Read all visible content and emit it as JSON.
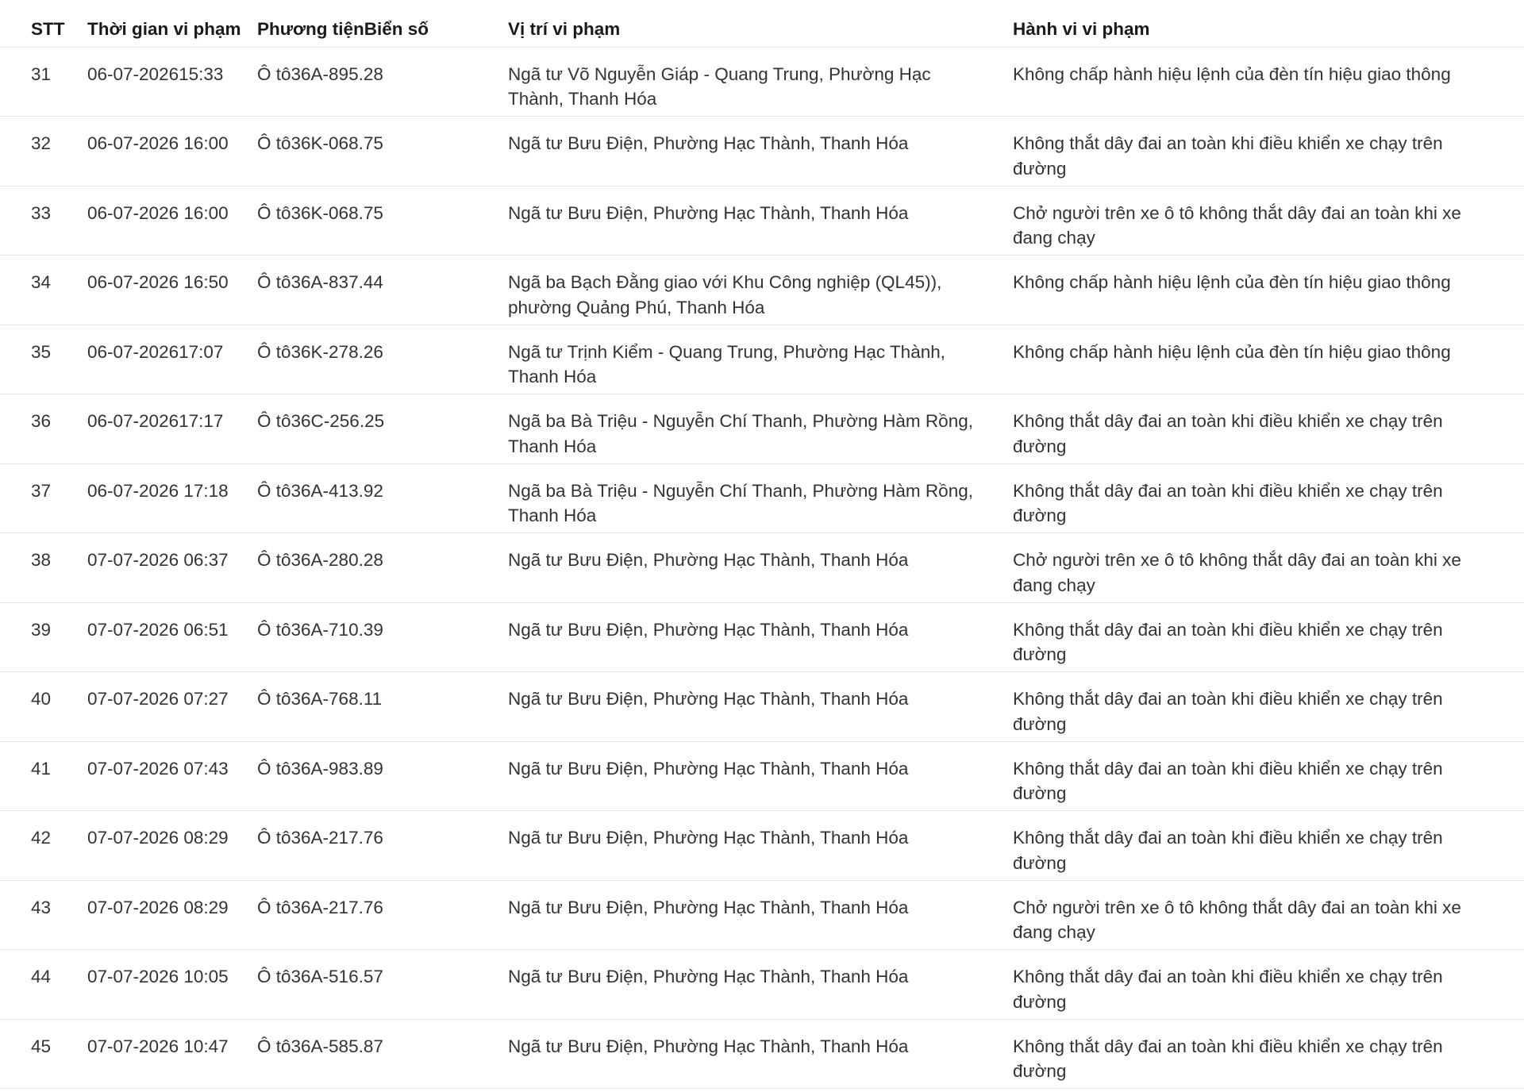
{
  "table": {
    "headers": {
      "stt": "STT",
      "time": "Thời gian vi phạm",
      "vehicle": "Phương tiệnBiển số",
      "location": "Vị trí vi phạm",
      "violation": "Hành vi vi phạm"
    },
    "rows": [
      {
        "stt": "31",
        "time": "06-07-202615:33",
        "vehicle": "Ô tô36A-895.28",
        "location": "Ngã tư Võ Nguyễn Giáp - Quang Trung, Phường Hạc Thành, Thanh Hóa",
        "violation": "Không chấp hành hiệu lệnh của đèn tín hiệu giao thông"
      },
      {
        "stt": "32",
        "time": "06-07-2026 16:00",
        "vehicle": "Ô tô36K-068.75",
        "location": "Ngã tư Bưu Điện, Phường Hạc Thành, Thanh Hóa",
        "violation": "Không thắt dây đai an toàn khi điều khiển xe chạy trên đường"
      },
      {
        "stt": "33",
        "time": "06-07-2026 16:00",
        "vehicle": "Ô tô36K-068.75",
        "location": "Ngã tư Bưu Điện, Phường Hạc Thành, Thanh Hóa",
        "violation": "Chở người trên xe ô tô không thắt dây đai an toàn khi xe đang chạy"
      },
      {
        "stt": "34",
        "time": "06-07-2026 16:50",
        "vehicle": "Ô tô36A-837.44",
        "location": "Ngã ba Bạch Đằng giao với Khu Công nghiệp (QL45)), phường Quảng Phú, Thanh Hóa",
        "violation": "Không chấp hành hiệu lệnh của đèn tín hiệu giao thông"
      },
      {
        "stt": "35",
        "time": "06-07-202617:07",
        "vehicle": "Ô tô36K-278.26",
        "location": "Ngã tư Trịnh Kiểm - Quang Trung, Phường Hạc Thành, Thanh Hóa",
        "violation": "Không chấp hành hiệu lệnh của đèn tín hiệu giao thông"
      },
      {
        "stt": "36",
        "time": "06-07-202617:17",
        "vehicle": "Ô tô36C-256.25",
        "location": "Ngã ba Bà Triệu - Nguyễn Chí Thanh, Phường Hàm Rồng, Thanh Hóa",
        "violation": "Không thắt dây đai an toàn khi điều khiển xe chạy trên đường"
      },
      {
        "stt": "37",
        "time": "06-07-2026 17:18",
        "vehicle": "Ô tô36A-413.92",
        "location": "Ngã ba Bà Triệu - Nguyễn Chí Thanh, Phường Hàm Rồng, Thanh Hóa",
        "violation": "Không thắt dây đai an toàn khi điều khiển xe chạy trên đường"
      },
      {
        "stt": "38",
        "time": "07-07-2026 06:37",
        "vehicle": "Ô tô36A-280.28",
        "location": "Ngã tư Bưu Điện, Phường Hạc Thành, Thanh Hóa",
        "violation": "Chở người trên xe ô tô không thắt dây đai an toàn khi xe đang chạy"
      },
      {
        "stt": "39",
        "time": "07-07-2026 06:51",
        "vehicle": "Ô tô36A-710.39",
        "location": "Ngã tư Bưu Điện, Phường Hạc Thành, Thanh Hóa",
        "violation": "Không thắt dây đai an toàn khi điều khiển xe chạy trên đường"
      },
      {
        "stt": "40",
        "time": "07-07-2026 07:27",
        "vehicle": "Ô tô36A-768.11",
        "location": "Ngã tư Bưu Điện, Phường Hạc Thành, Thanh Hóa",
        "violation": "Không thắt dây đai an toàn khi điều khiển xe chạy trên đường"
      },
      {
        "stt": "41",
        "time": "07-07-2026 07:43",
        "vehicle": "Ô tô36A-983.89",
        "location": "Ngã tư Bưu Điện, Phường Hạc Thành, Thanh Hóa",
        "violation": "Không thắt dây đai an toàn khi điều khiển xe chạy trên đường"
      },
      {
        "stt": "42",
        "time": "07-07-2026 08:29",
        "vehicle": "Ô tô36A-217.76",
        "location": "Ngã tư Bưu Điện, Phường Hạc Thành, Thanh Hóa",
        "violation": "Không thắt dây đai an toàn khi điều khiển xe chạy trên đường"
      },
      {
        "stt": "43",
        "time": "07-07-2026 08:29",
        "vehicle": "Ô tô36A-217.76",
        "location": "Ngã tư Bưu Điện, Phường Hạc Thành, Thanh Hóa",
        "violation": "Chở người trên xe ô tô không thắt dây đai an toàn khi xe đang chạy"
      },
      {
        "stt": "44",
        "time": "07-07-2026 10:05",
        "vehicle": "Ô tô36A-516.57",
        "location": "Ngã tư Bưu Điện, Phường Hạc Thành, Thanh Hóa",
        "violation": "Không thắt dây đai an toàn khi điều khiển xe chạy trên đường"
      },
      {
        "stt": "45",
        "time": "07-07-2026 10:47",
        "vehicle": "Ô tô36A-585.87",
        "location": "Ngã tư Bưu Điện, Phường Hạc Thành, Thanh Hóa",
        "violation": "Không thắt dây đai an toàn khi điều khiển xe chạy trên đường"
      }
    ]
  }
}
